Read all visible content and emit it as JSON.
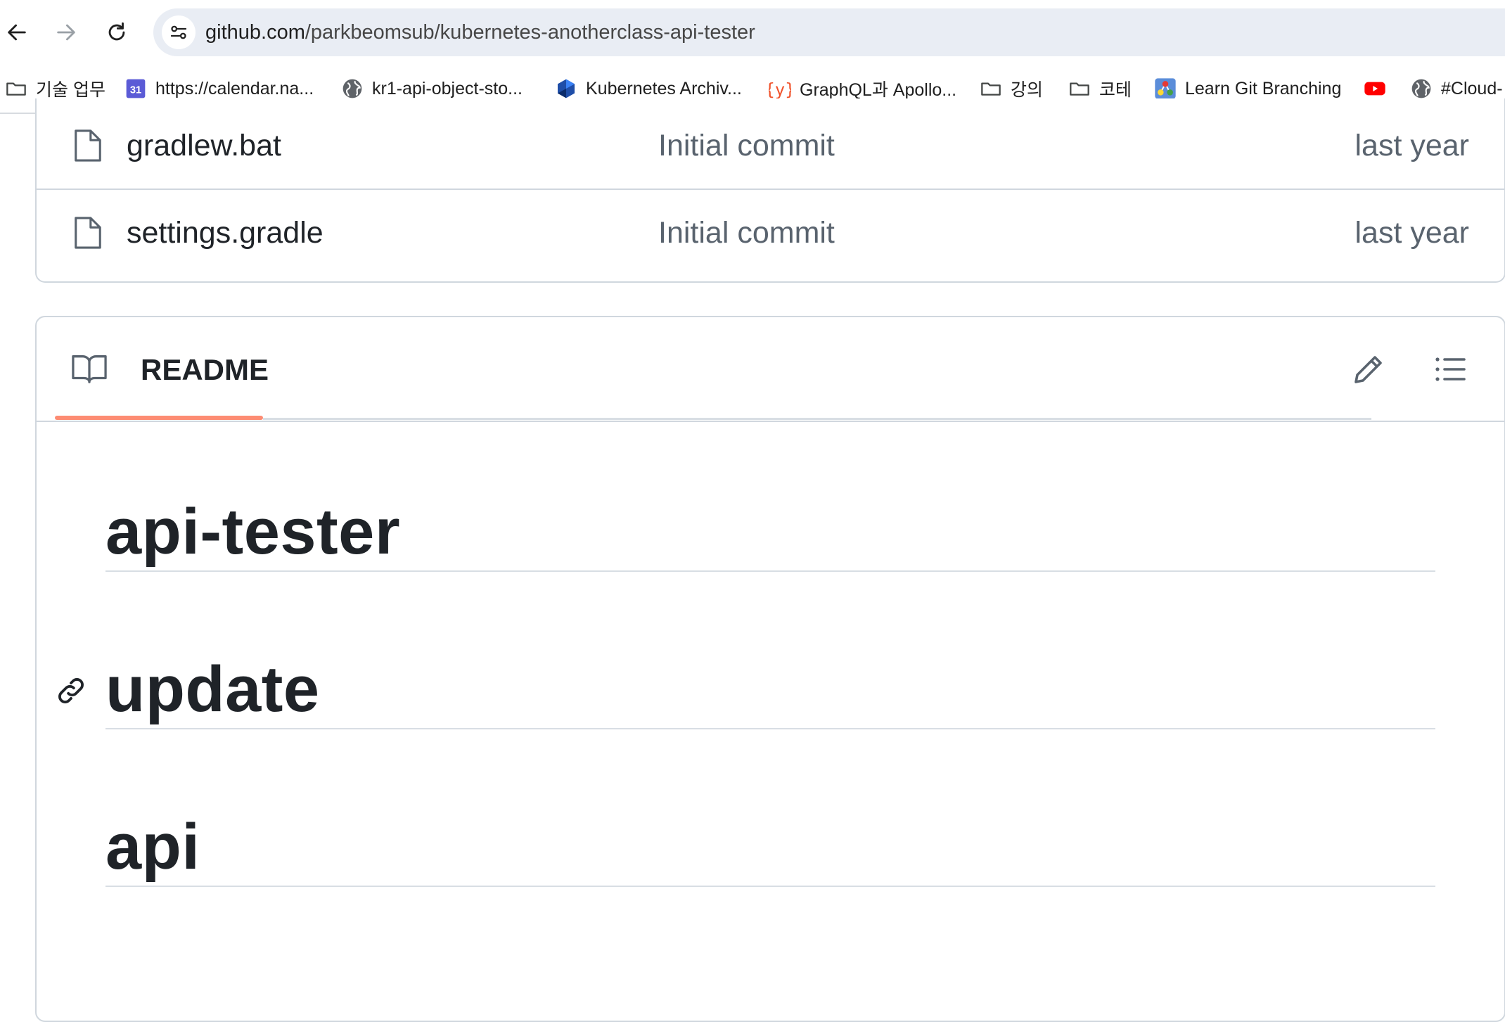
{
  "browser": {
    "url_host": "github.com",
    "url_path": "/parkbeomsub/kubernetes-anotherclass-api-tester",
    "bookmarks": [
      {
        "label": "기술 업무",
        "icon": "folder-icon"
      },
      {
        "label": "https://calendar.na...",
        "icon": "calendar-icon"
      },
      {
        "label": "kr1-api-object-sto...",
        "icon": "globe-icon"
      },
      {
        "label": "Kubernetes Archiv...",
        "icon": "kubernetes-icon"
      },
      {
        "label": "GraphQL과 Apollo...",
        "icon": "graphql-icon"
      },
      {
        "label": "강의",
        "icon": "folder-icon"
      },
      {
        "label": "코테",
        "icon": "folder-icon"
      },
      {
        "label": "Learn Git Branching",
        "icon": "git-branching-icon"
      },
      {
        "label": "",
        "icon": "youtube-icon"
      },
      {
        "label": "#Cloud-",
        "icon": "globe-icon"
      }
    ],
    "calendar_icon_number": "31"
  },
  "files": [
    {
      "name": "gradlew.bat",
      "commit": "Initial commit",
      "time": "last year"
    },
    {
      "name": "settings.gradle",
      "commit": "Initial commit",
      "time": "last year"
    }
  ],
  "readme": {
    "tab_label": "README",
    "headings": [
      "api-tester",
      "update",
      "api"
    ]
  },
  "colors": {
    "tab_underline": "#fd8c73",
    "border": "#d0d7de",
    "muted_text": "#59636e"
  }
}
